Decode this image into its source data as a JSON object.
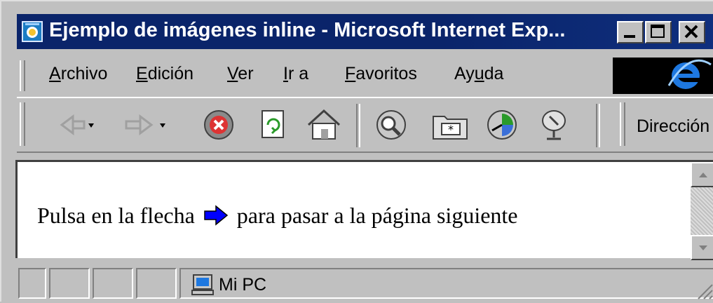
{
  "window": {
    "title": "Ejemplo de imágenes inline - Microsoft Internet Exp...",
    "buttons": [
      "minimize",
      "maximize",
      "close"
    ]
  },
  "menu": {
    "items": [
      {
        "label_ul": "A",
        "label_rest": "rchivo"
      },
      {
        "label_ul": "E",
        "label_rest": "dición"
      },
      {
        "label_ul": "V",
        "label_rest": "er"
      },
      {
        "label_ul": "I",
        "label_rest": "r a"
      },
      {
        "label_ul": "F",
        "label_rest": "avoritos"
      },
      {
        "label_pre": "Ay",
        "label_ul": "u",
        "label_rest": "da"
      }
    ]
  },
  "toolbar": {
    "icons": [
      "back-icon",
      "forward-icon",
      "stop-icon",
      "refresh-icon",
      "home-icon",
      "search-icon",
      "favorites-icon",
      "history-icon",
      "channels-icon"
    ],
    "address_label": "Dirección"
  },
  "content": {
    "text_before": "Pulsa en la flecha",
    "text_after": "para pasar a la página siguiente",
    "arrow_icon": "right-arrow-icon",
    "arrow_color": "#0000ff"
  },
  "status": {
    "zone_label": "Mi PC",
    "zone_icon": "computer-icon"
  },
  "colors": {
    "titlebar": "#0a246a",
    "chrome": "#c0c0c0"
  }
}
